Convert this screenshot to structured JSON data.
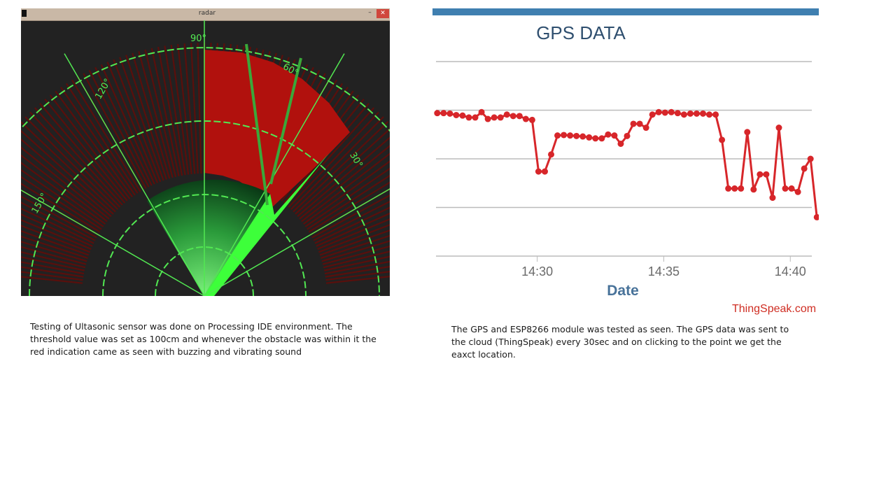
{
  "radar_window": {
    "title": "radar",
    "minimize_label": "–",
    "close_label": "✕",
    "angle_labels": [
      "90°",
      "60°",
      "30°",
      "120°",
      "150°"
    ]
  },
  "radar_caption": "Testing of Ultasonic sensor was done on Processing IDE environment. The threshold value was set as 100cm and whenever the obstacle was within it the red indication came as seen with buzzing and vibrating sound",
  "gps_panel": {
    "brand": "ThingSpeak.com",
    "caption": "The GPS and ESP8266 module was tested as seen. The GPS data was sent to the cloud (ThingSpeak) every 30sec and on clicking to the point we get the eaxct location."
  },
  "colors": {
    "accent_bar": "#3f7fb0",
    "series_line": "#d7262a",
    "radar_red": "#c0100c",
    "radar_green": "#3dff3a"
  },
  "chart_data": {
    "type": "line",
    "title": "GPS DATA",
    "xlabel": "Date",
    "ylabel": "",
    "x_ticks": [
      "14:30",
      "14:35",
      "14:40"
    ],
    "x_range_minutes": [
      26.0,
      40.85
    ],
    "y_range": [
      0,
      4
    ],
    "grid": true,
    "series": [
      {
        "values": [
          [
            26.05,
            2.94
          ],
          [
            26.3,
            2.94
          ],
          [
            26.55,
            2.93
          ],
          [
            26.8,
            2.9
          ],
          [
            27.05,
            2.89
          ],
          [
            27.3,
            2.85
          ],
          [
            27.55,
            2.85
          ],
          [
            27.8,
            2.96
          ],
          [
            28.05,
            2.82
          ],
          [
            28.3,
            2.85
          ],
          [
            28.55,
            2.85
          ],
          [
            28.8,
            2.91
          ],
          [
            29.05,
            2.88
          ],
          [
            29.3,
            2.88
          ],
          [
            29.55,
            2.82
          ],
          [
            29.8,
            2.8
          ],
          [
            30.05,
            1.74
          ],
          [
            30.3,
            1.74
          ],
          [
            30.55,
            2.09
          ],
          [
            30.8,
            2.48
          ],
          [
            31.05,
            2.49
          ],
          [
            31.3,
            2.48
          ],
          [
            31.55,
            2.47
          ],
          [
            31.8,
            2.46
          ],
          [
            32.05,
            2.44
          ],
          [
            32.3,
            2.42
          ],
          [
            32.55,
            2.42
          ],
          [
            32.8,
            2.5
          ],
          [
            33.05,
            2.48
          ],
          [
            33.3,
            2.31
          ],
          [
            33.55,
            2.47
          ],
          [
            33.8,
            2.72
          ],
          [
            34.05,
            2.72
          ],
          [
            34.3,
            2.64
          ],
          [
            34.55,
            2.91
          ],
          [
            34.8,
            2.96
          ],
          [
            35.05,
            2.95
          ],
          [
            35.3,
            2.96
          ],
          [
            35.55,
            2.94
          ],
          [
            35.8,
            2.91
          ],
          [
            36.05,
            2.93
          ],
          [
            36.3,
            2.93
          ],
          [
            36.55,
            2.93
          ],
          [
            36.8,
            2.91
          ],
          [
            37.05,
            2.91
          ],
          [
            37.3,
            2.39
          ],
          [
            37.55,
            1.39
          ],
          [
            37.8,
            1.39
          ],
          [
            38.05,
            1.39
          ],
          [
            38.3,
            2.55
          ],
          [
            38.55,
            1.37
          ],
          [
            38.8,
            1.68
          ],
          [
            39.05,
            1.68
          ],
          [
            39.3,
            1.2
          ],
          [
            39.55,
            2.64
          ],
          [
            39.8,
            1.39
          ],
          [
            40.05,
            1.39
          ],
          [
            40.3,
            1.32
          ],
          [
            40.55,
            1.8
          ],
          [
            40.8,
            2.0
          ],
          [
            41.05,
            0.8
          ]
        ]
      }
    ]
  }
}
